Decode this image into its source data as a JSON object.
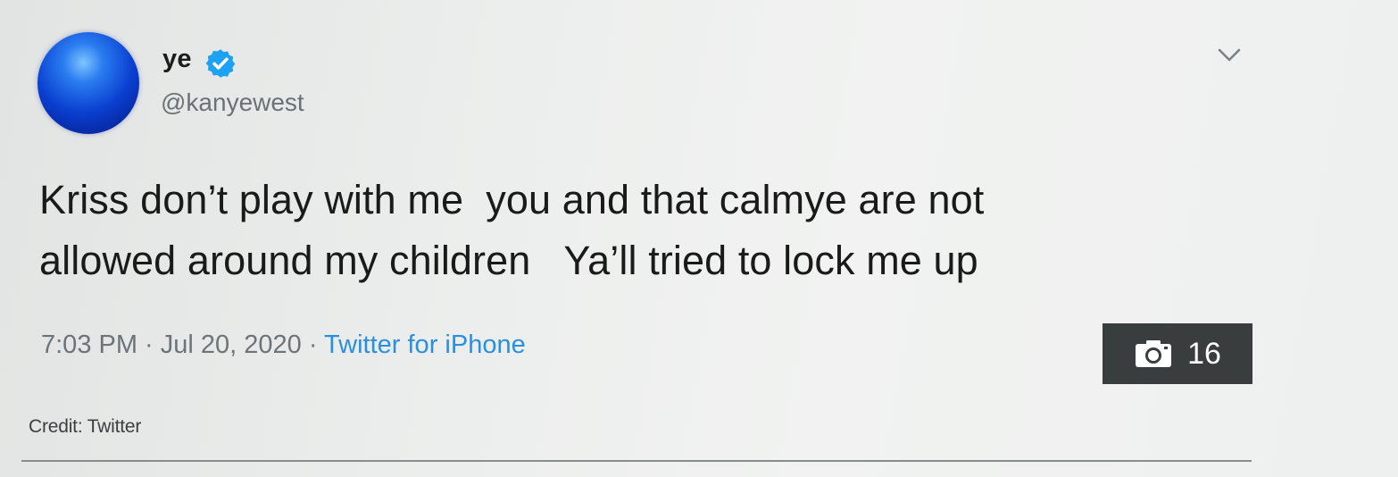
{
  "tweet": {
    "display_name": "ye",
    "handle": "@kanyewest",
    "verified": true,
    "text": "Kriss don’t play with me  you and that calmye are not\nallowed around my children   Ya’ll tried to lock me up",
    "time": "7:03 PM",
    "separator1": " · ",
    "date": "Jul 20, 2020",
    "separator2": " · ",
    "source": "Twitter for iPhone"
  },
  "gallery": {
    "icon": "camera-icon",
    "count": "16"
  },
  "credit": "Credit: Twitter",
  "colors": {
    "verified_blue": "#1da1f2",
    "link_blue": "#2a8fdc",
    "badge_bg": "#3a3d3d"
  }
}
